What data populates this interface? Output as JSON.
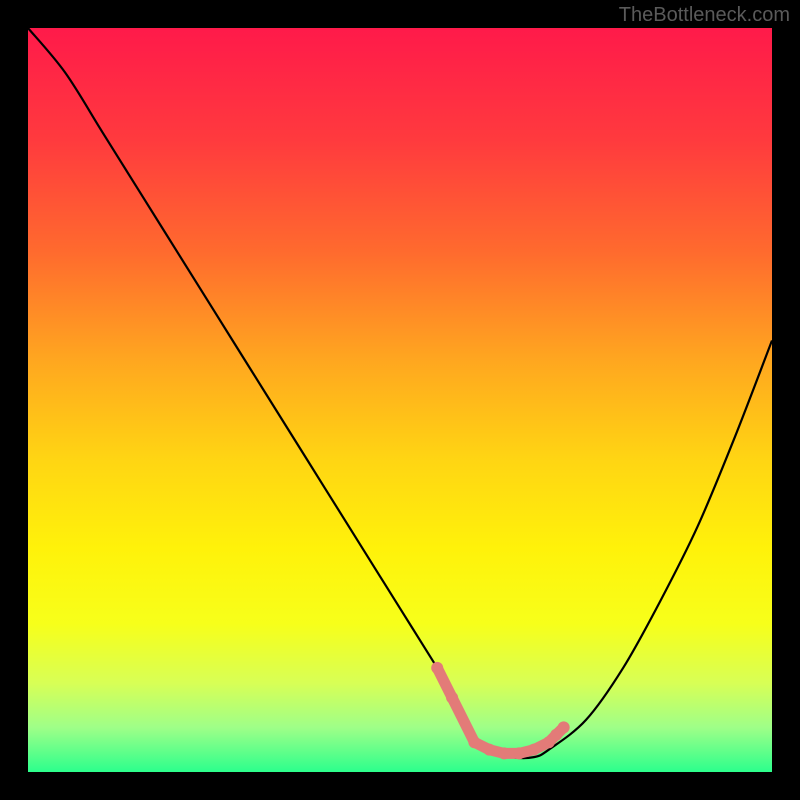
{
  "watermark": "TheBottleneck.com",
  "chart_data": {
    "type": "line",
    "title": "",
    "xlabel": "",
    "ylabel": "",
    "xlim": [
      0,
      100
    ],
    "ylim": [
      0,
      100
    ],
    "grid": false,
    "legend": false,
    "background_gradient_stops": [
      {
        "offset": 0.0,
        "color": "#ff1a4a"
      },
      {
        "offset": 0.15,
        "color": "#ff3a3e"
      },
      {
        "offset": 0.3,
        "color": "#ff6a2e"
      },
      {
        "offset": 0.45,
        "color": "#ffa81f"
      },
      {
        "offset": 0.58,
        "color": "#ffd513"
      },
      {
        "offset": 0.7,
        "color": "#fff20a"
      },
      {
        "offset": 0.8,
        "color": "#f7ff1a"
      },
      {
        "offset": 0.88,
        "color": "#d8ff55"
      },
      {
        "offset": 0.94,
        "color": "#9fff88"
      },
      {
        "offset": 1.0,
        "color": "#2cff8c"
      }
    ],
    "series": [
      {
        "name": "bottleneck-curve",
        "color": "#000000",
        "x": [
          0,
          5,
          10,
          15,
          20,
          25,
          30,
          35,
          40,
          45,
          50,
          55,
          58,
          60,
          62,
          65,
          68,
          70,
          75,
          80,
          85,
          90,
          95,
          100
        ],
        "y": [
          100,
          94,
          86,
          78,
          70,
          62,
          54,
          46,
          38,
          30,
          22,
          14,
          9,
          5,
          3,
          2,
          2,
          3,
          7,
          14,
          23,
          33,
          45,
          58
        ]
      }
    ],
    "markers": {
      "name": "highlight-range-markers",
      "color": "#e37b78",
      "points": [
        {
          "x": 55,
          "y": 14
        },
        {
          "x": 57,
          "y": 10
        },
        {
          "x": 60,
          "y": 4
        },
        {
          "x": 62,
          "y": 3
        },
        {
          "x": 64,
          "y": 2.5
        },
        {
          "x": 66,
          "y": 2.5
        },
        {
          "x": 68,
          "y": 3
        },
        {
          "x": 70,
          "y": 4
        },
        {
          "x": 71,
          "y": 5
        },
        {
          "x": 72,
          "y": 6
        }
      ]
    }
  }
}
